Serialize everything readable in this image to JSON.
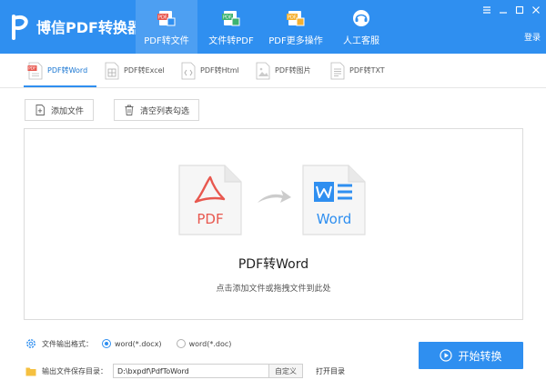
{
  "app": {
    "title": "博信PDF转换器",
    "logo_icon": "p-logo-icon"
  },
  "nav": {
    "tabs": [
      {
        "label": "PDF转文件",
        "icon": "pdf-to-file-icon",
        "active": true
      },
      {
        "label": "文件转PDF",
        "icon": "file-to-pdf-icon",
        "active": false
      },
      {
        "label": "PDF更多操作",
        "icon": "pdf-more-icon",
        "active": false
      },
      {
        "label": "人工客服",
        "icon": "headset-icon",
        "active": false
      }
    ]
  },
  "window": {
    "login_label": "登录",
    "controls": [
      "menu-icon",
      "minimize-icon",
      "restore-icon",
      "close-icon"
    ]
  },
  "subtabs": [
    {
      "label": "PDF转Word",
      "active": true
    },
    {
      "label": "PDF转Excel",
      "active": false
    },
    {
      "label": "PDF转Html",
      "active": false
    },
    {
      "label": "PDF转图片",
      "active": false
    },
    {
      "label": "PDF转TXT",
      "active": false
    }
  ],
  "toolbar": {
    "add_label": "添加文件",
    "clear_label": "清空列表勾选"
  },
  "dropzone": {
    "source_doc_text": "PDF",
    "target_doc_text": "Word",
    "title": "PDF转Word",
    "hint": "点击添加文件或拖拽文件到此处"
  },
  "output_format": {
    "label": "文件输出格式：",
    "options": [
      {
        "label": "word(*.docx)",
        "checked": true
      },
      {
        "label": "word(*.doc)",
        "checked": false
      }
    ]
  },
  "output_dir": {
    "label": "输出文件保存目录：",
    "path": "D:\\bxpdf\\PdfToWord",
    "custom_label": "自定义",
    "open_label": "打开目录"
  },
  "start": {
    "label": "开始转换"
  },
  "colors": {
    "primary": "#2f8ff0",
    "active_tab": "#4d9ff2",
    "pdf_red": "#e8584f",
    "word_blue": "#2f8ff0"
  }
}
